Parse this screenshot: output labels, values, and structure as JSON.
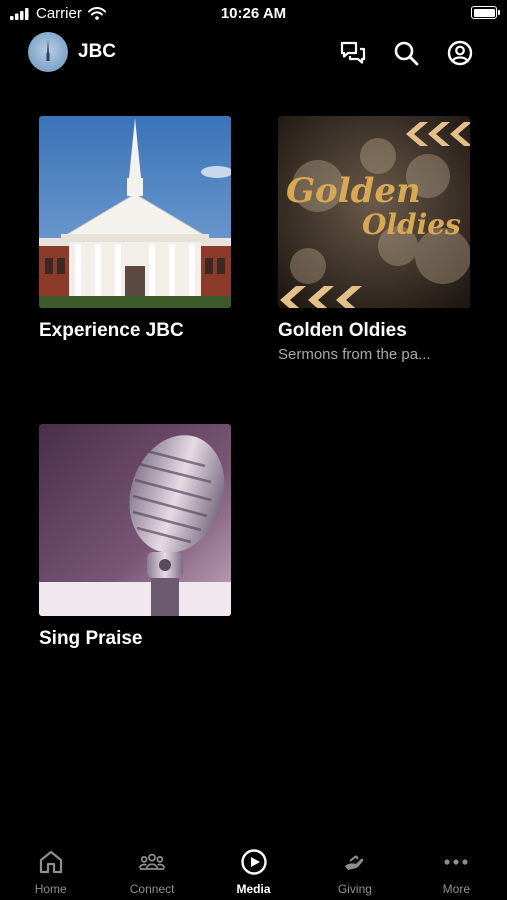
{
  "status_bar": {
    "carrier": "Carrier",
    "time": "10:26 AM"
  },
  "header": {
    "title": "JBC"
  },
  "cards": [
    {
      "title": "Experience JBC",
      "subtitle": ""
    },
    {
      "title": "Golden Oldies",
      "subtitle": "Sermons from the pa...",
      "art_text_1": "Golden",
      "art_text_2": "Oldies"
    },
    {
      "title": "Sing Praise",
      "subtitle": ""
    }
  ],
  "tabs": [
    {
      "label": "Home",
      "icon": "home-icon",
      "active": false
    },
    {
      "label": "Connect",
      "icon": "people-icon",
      "active": false
    },
    {
      "label": "Media",
      "icon": "play-circle-icon",
      "active": true
    },
    {
      "label": "Giving",
      "icon": "hand-icon",
      "active": false
    },
    {
      "label": "More",
      "icon": "more-dots-icon",
      "active": false
    }
  ],
  "colors": {
    "background": "#000000",
    "inactive_tab": "#8e8e8e",
    "subtitle": "#a8a8a8"
  }
}
